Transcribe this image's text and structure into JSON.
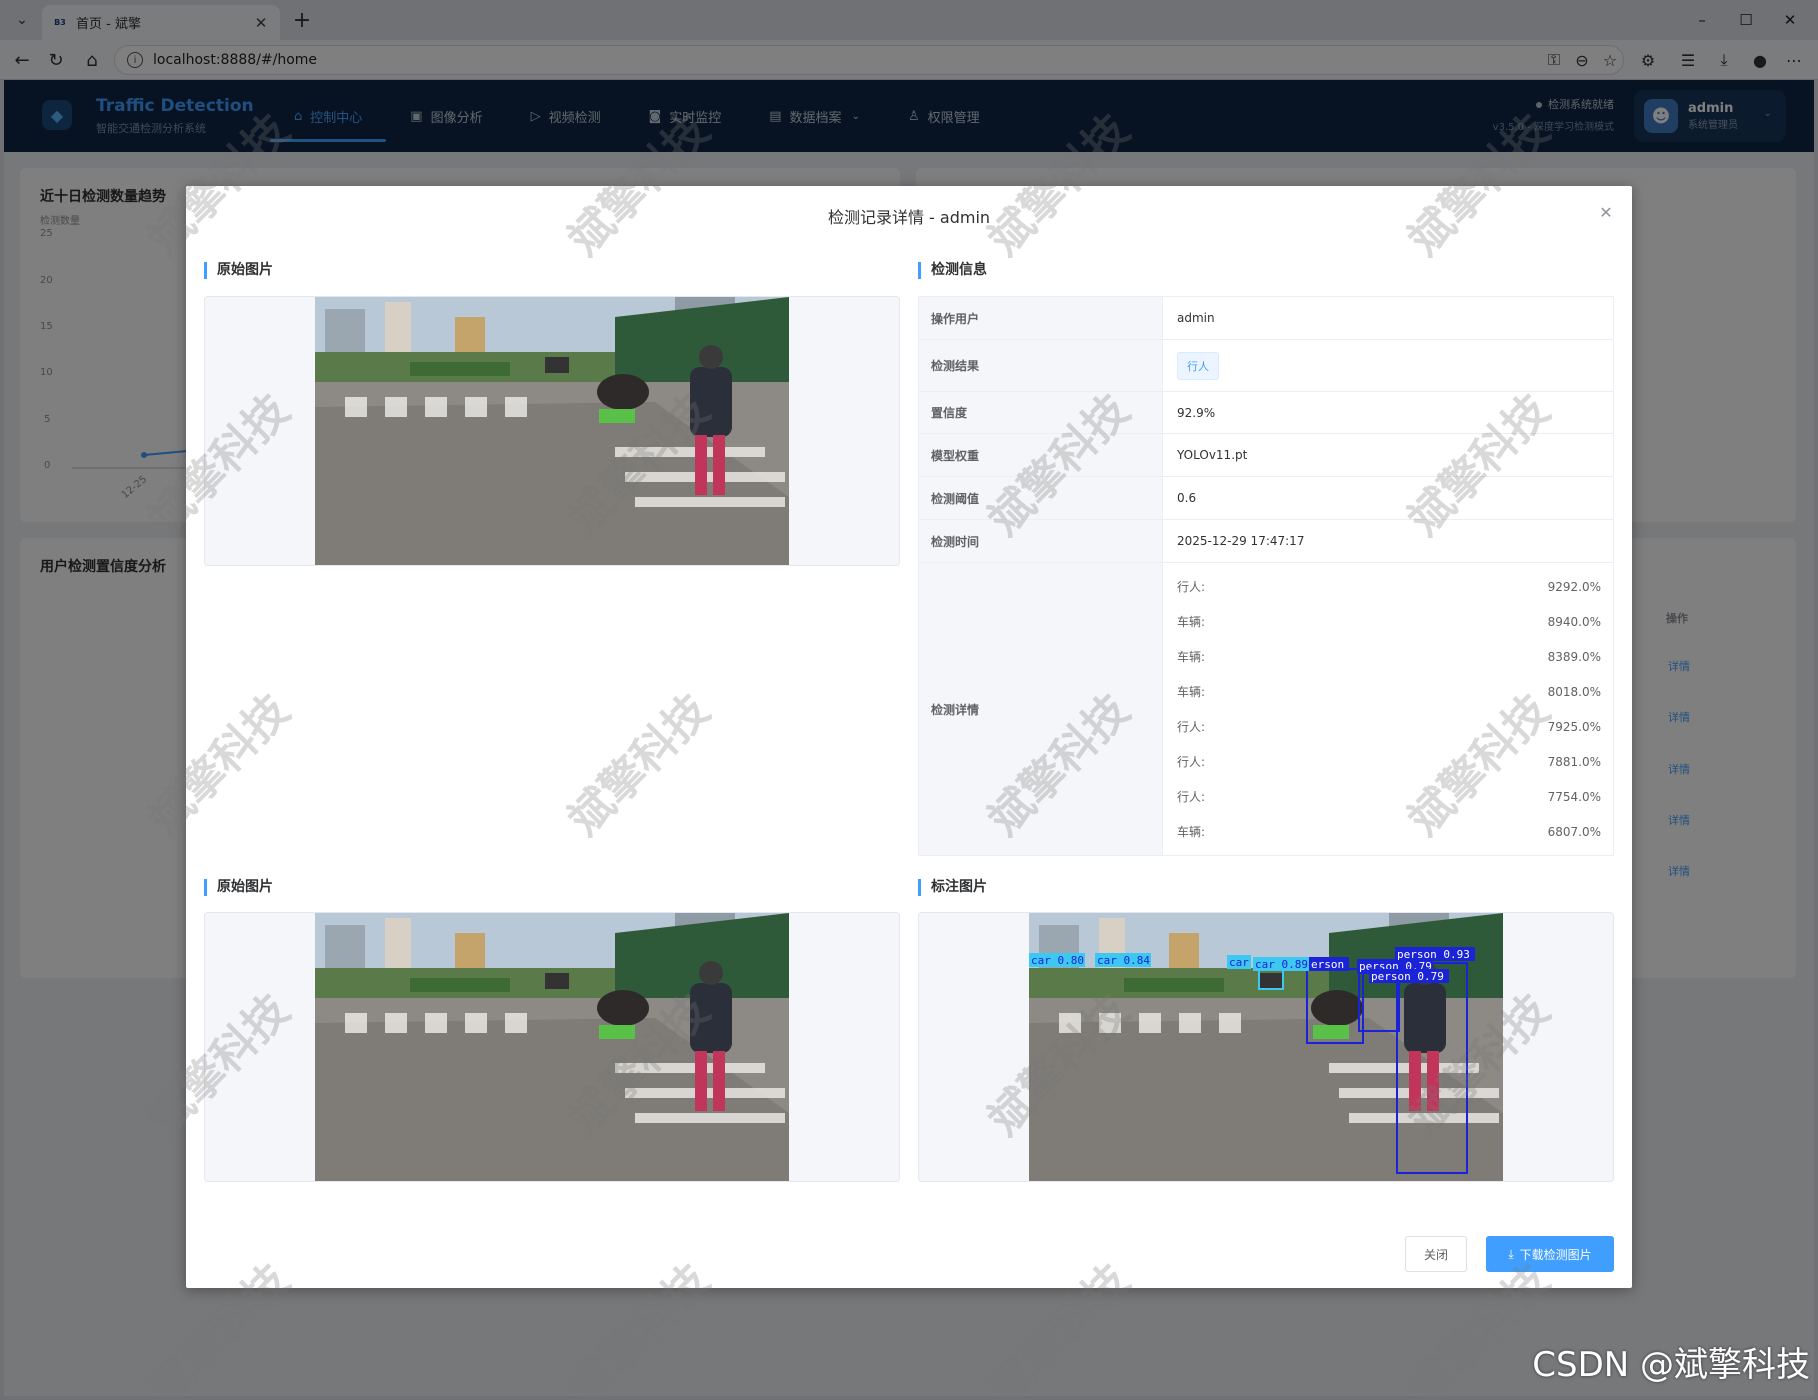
{
  "browser": {
    "tab_favicon": "B3",
    "tab_title": "首页 - 斌擎",
    "url": "localhost:8888/#/home"
  },
  "app": {
    "brand_title": "Traffic Detection",
    "brand_subtitle": "智能交通检测分析系统",
    "menu": [
      {
        "label": "控制中心",
        "icon": "home-icon",
        "active": true
      },
      {
        "label": "图像分析",
        "icon": "image-icon"
      },
      {
        "label": "视频检测",
        "icon": "play-icon"
      },
      {
        "label": "实时监控",
        "icon": "camera-icon"
      },
      {
        "label": "数据档案",
        "icon": "document-icon"
      },
      {
        "label": "权限管理",
        "icon": "user-icon"
      }
    ],
    "status": "检测系统就绪",
    "version": "v3.5.0 - 深度学习检测模式",
    "user_name": "admin",
    "user_role": "系统管理员"
  },
  "background": {
    "trend_title": "近十日检测数量趋势",
    "trend_ylabel": "检测数量",
    "trend_yticks": [
      "25",
      "20",
      "15",
      "10",
      "5",
      "0"
    ],
    "trend_xtick": "12-25",
    "confidence_title": "用户检测置信度分析",
    "table_op_header": "操作",
    "table_op_links": [
      "详情",
      "详情",
      "详情",
      "详情",
      "详情"
    ]
  },
  "dialog": {
    "title": "检测记录详情 - admin",
    "original_title": "原始图片",
    "info_title": "检测信息",
    "original_title_2": "原始图片",
    "annotated_title": "标注图片",
    "fields": [
      {
        "label": "操作用户",
        "value": "admin"
      },
      {
        "label": "检测结果",
        "value": "行人",
        "is_tag": true
      },
      {
        "label": "置信度",
        "value": "92.9%"
      },
      {
        "label": "模型权重",
        "value": "YOLOv11.pt"
      },
      {
        "label": "检测阈值",
        "value": "0.6"
      },
      {
        "label": "检测时间",
        "value": "2025-12-29 17:47:17"
      }
    ],
    "details_label": "检测详情",
    "details": [
      {
        "name": "行人:",
        "value": "9292.0%"
      },
      {
        "name": "车辆:",
        "value": "8940.0%"
      },
      {
        "name": "车辆:",
        "value": "8389.0%"
      },
      {
        "name": "车辆:",
        "value": "8018.0%"
      },
      {
        "name": "行人:",
        "value": "7925.0%"
      },
      {
        "name": "行人:",
        "value": "7881.0%"
      },
      {
        "name": "行人:",
        "value": "7754.0%"
      },
      {
        "name": "车辆:",
        "value": "6807.0%"
      }
    ],
    "annotations": [
      "car 0.80",
      "car 0.84",
      "car",
      "car 0.89",
      "erson",
      "person 0.79",
      "person 0.93",
      "person 0.79"
    ],
    "close_label": "关闭",
    "download_label": "下载检测图片"
  },
  "watermark": "斌擎科技",
  "footer_mark": "CSDN @斌擎科技"
}
